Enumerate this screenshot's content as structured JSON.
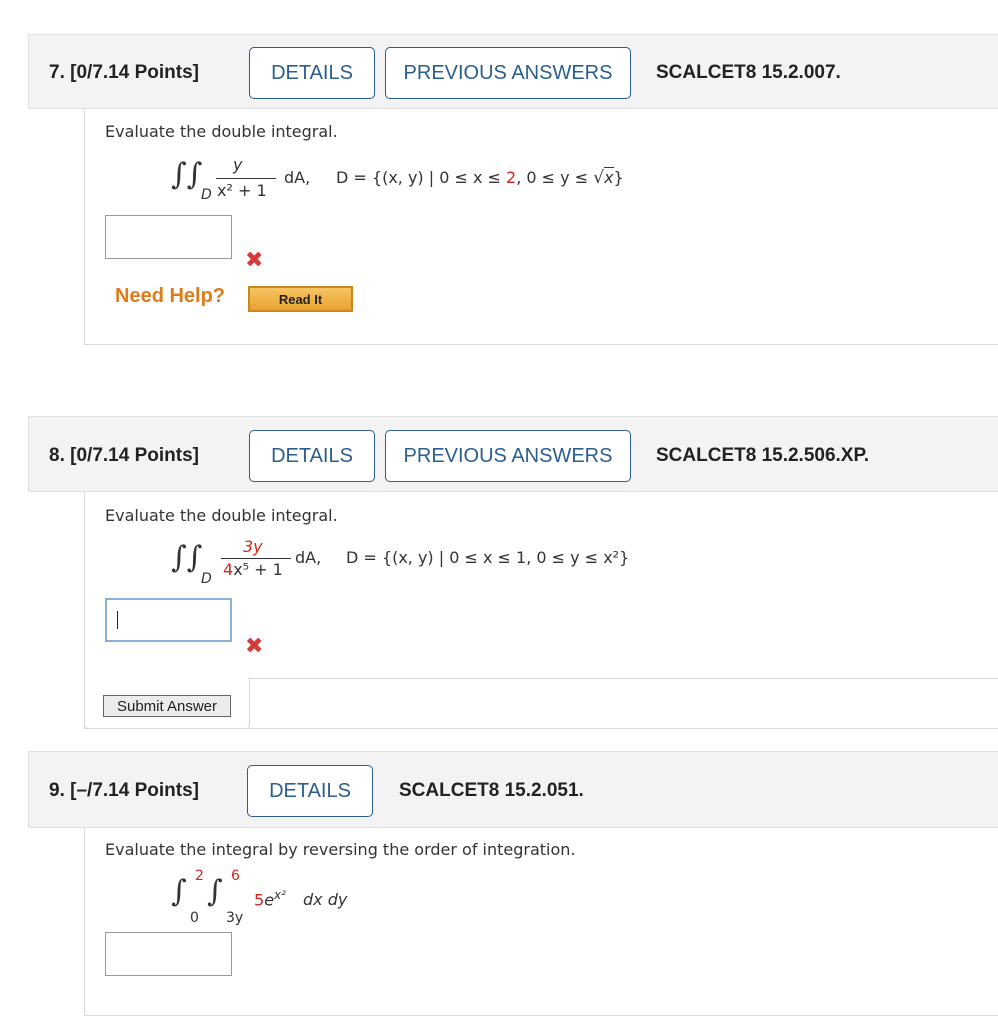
{
  "questions": [
    {
      "number": "7.",
      "points": "[0/7.14 Points]",
      "details_label": "DETAILS",
      "previous_answers_label": "PREVIOUS ANSWERS",
      "code": "SCALCET8 15.2.007.",
      "prompt": "Evaluate the double integral.",
      "math": {
        "numerator": "y",
        "denominator": "x² + 1",
        "differential": "dA,",
        "region_prefix": "D = {(x, y) | 0 ≤ x ≤ ",
        "region_red": "2",
        "region_mid": ", 0 ≤ y ≤ ",
        "region_sqrt": "x",
        "region_suffix": "}",
        "domain_sub": "D"
      },
      "answer_value": "",
      "result": "incorrect",
      "need_help_label": "Need Help?",
      "read_it_label": "Read It"
    },
    {
      "number": "8.",
      "points": "[0/7.14 Points]",
      "details_label": "DETAILS",
      "previous_answers_label": "PREVIOUS ANSWERS",
      "code": "SCALCET8 15.2.506.XP.",
      "prompt": "Evaluate the double integral.",
      "math": {
        "numerator": "3y",
        "denominator_coef": "4",
        "denominator_rest": "x⁵ + 1",
        "differential": "dA,",
        "region": "D = {(x, y) | 0 ≤ x ≤ 1, 0 ≤ y ≤ x²}",
        "domain_sub": "D"
      },
      "answer_value": "",
      "result": "incorrect",
      "submit_label": "Submit Answer"
    },
    {
      "number": "9.",
      "points": "[–/7.14 Points]",
      "details_label": "DETAILS",
      "code": "SCALCET8 15.2.051.",
      "prompt": "Evaluate the integral by reversing the order of integration.",
      "math": {
        "outer_upper": "2",
        "outer_lower": "0",
        "inner_upper": "6",
        "inner_lower": "3y",
        "coef": "5",
        "base": "e",
        "exponent": "x²",
        "differentials": "dx dy"
      },
      "answer_value": ""
    }
  ],
  "colors": {
    "link_blue": "#2b5e8f",
    "highlight_red": "#d0271d",
    "need_help_orange": "#e07b1a"
  }
}
